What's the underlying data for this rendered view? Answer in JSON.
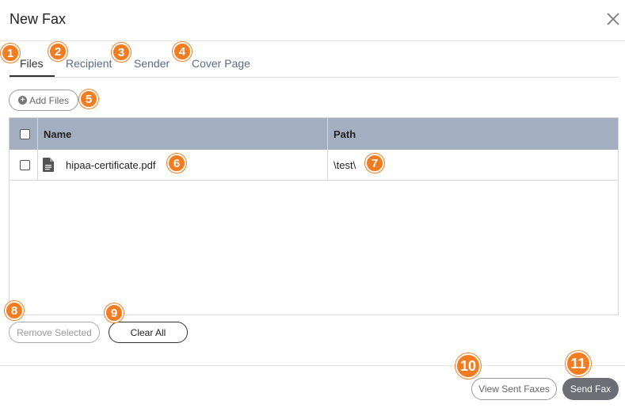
{
  "dialog": {
    "title": "New Fax",
    "close_icon": "close-icon"
  },
  "tabs": [
    {
      "label": "Files",
      "active": true
    },
    {
      "label": "Recipient",
      "active": false
    },
    {
      "label": "Sender",
      "active": false
    },
    {
      "label": "Cover Page",
      "active": false
    }
  ],
  "toolbar": {
    "add_files_label": "Add Files",
    "add_files_icon": "plus-circle-icon"
  },
  "table": {
    "columns": [
      "Name",
      "Path"
    ],
    "rows": [
      {
        "name": "hipaa-certificate.pdf",
        "path": "\\test\\",
        "icon": "file-document-icon",
        "checked": false
      }
    ]
  },
  "actions": {
    "remove_selected_label": "Remove Selected",
    "clear_all_label": "Clear All"
  },
  "footer": {
    "view_sent_label": "View Sent Faxes",
    "send_label": "Send Fax"
  },
  "markers": [
    "1",
    "2",
    "3",
    "4",
    "5",
    "6",
    "7",
    "8",
    "9",
    "10",
    "11"
  ],
  "colors": {
    "marker": "#f47c20",
    "table_header": "#a3aec0",
    "send_button": "#6b6f75",
    "tab_inactive": "#5a6b84"
  }
}
